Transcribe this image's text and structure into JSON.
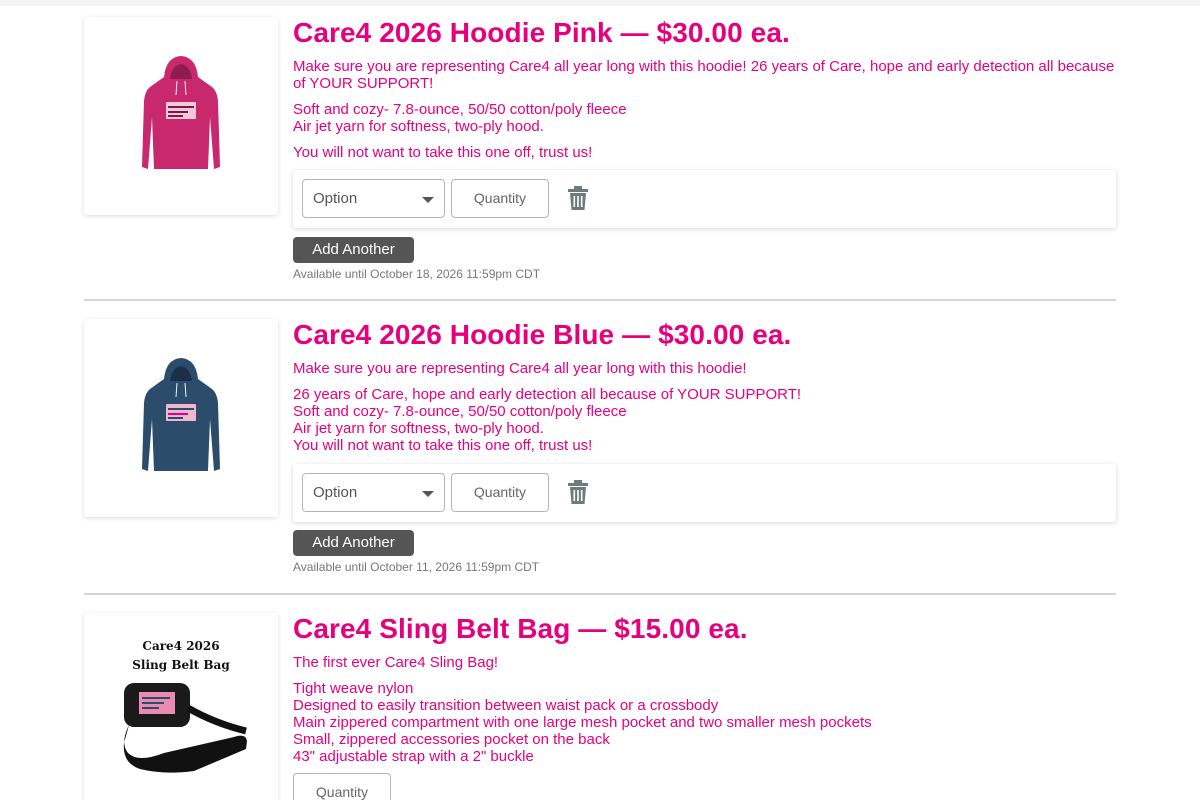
{
  "products": [
    {
      "title": "Care4 2026 Hoodie Pink — $30.00 ea.",
      "hoodie_color": "#c8286e",
      "description": [
        "Make sure you are representing Care4 all year long with this hoodie!  26 years of Care, hope and early detection all because of YOUR SUPPORT!",
        "Soft and cozy- 7.8-ounce, 50/50 cotton/poly fleece",
        "Air jet yarn for softness, two-ply hood.",
        "You will not want to take this one off, trust us!"
      ],
      "option_placeholder": "Option",
      "quantity_placeholder": "Quantity",
      "add_another_label": "Add Another",
      "availability": "Available until October 18, 2026 11:59pm CDT"
    },
    {
      "title": "Care4 2026 Hoodie Blue — $30.00 ea.",
      "hoodie_color": "#2c4c6b",
      "description": [
        "Make sure you are representing Care4 all year long with this hoodie!",
        "26 years of Care, hope and early detection all because of YOUR SUPPORT!",
        "Soft and cozy- 7.8-ounce, 50/50 cotton/poly fleece",
        "Air jet yarn for softness, two-ply hood.",
        "You will not want to take this one off, trust us!"
      ],
      "option_placeholder": "Option",
      "quantity_placeholder": "Quantity",
      "add_another_label": "Add Another",
      "availability": "Available until October 11, 2026 11:59pm CDT"
    },
    {
      "title": "Care4 Sling Belt Bag — $15.00 ea.",
      "image_caption_line1": "Care4 2026",
      "image_caption_line2": "Sling Belt Bag",
      "description": [
        "The first ever Care4 Sling Bag!",
        "Tight weave nylon",
        "Designed to easily transition between waist pack or a crossbody",
        "Main zippered compartment with one large mesh pocket and two smaller mesh pockets",
        "Small, zippered accessories pocket on the back",
        "43\" adjustable strap with a 2\" buckle"
      ],
      "quantity_placeholder": "Quantity"
    }
  ],
  "colors": {
    "accent": "#e6007e",
    "button_bg": "#555555",
    "muted_text": "#777777",
    "divider": "#d5d5d5"
  }
}
